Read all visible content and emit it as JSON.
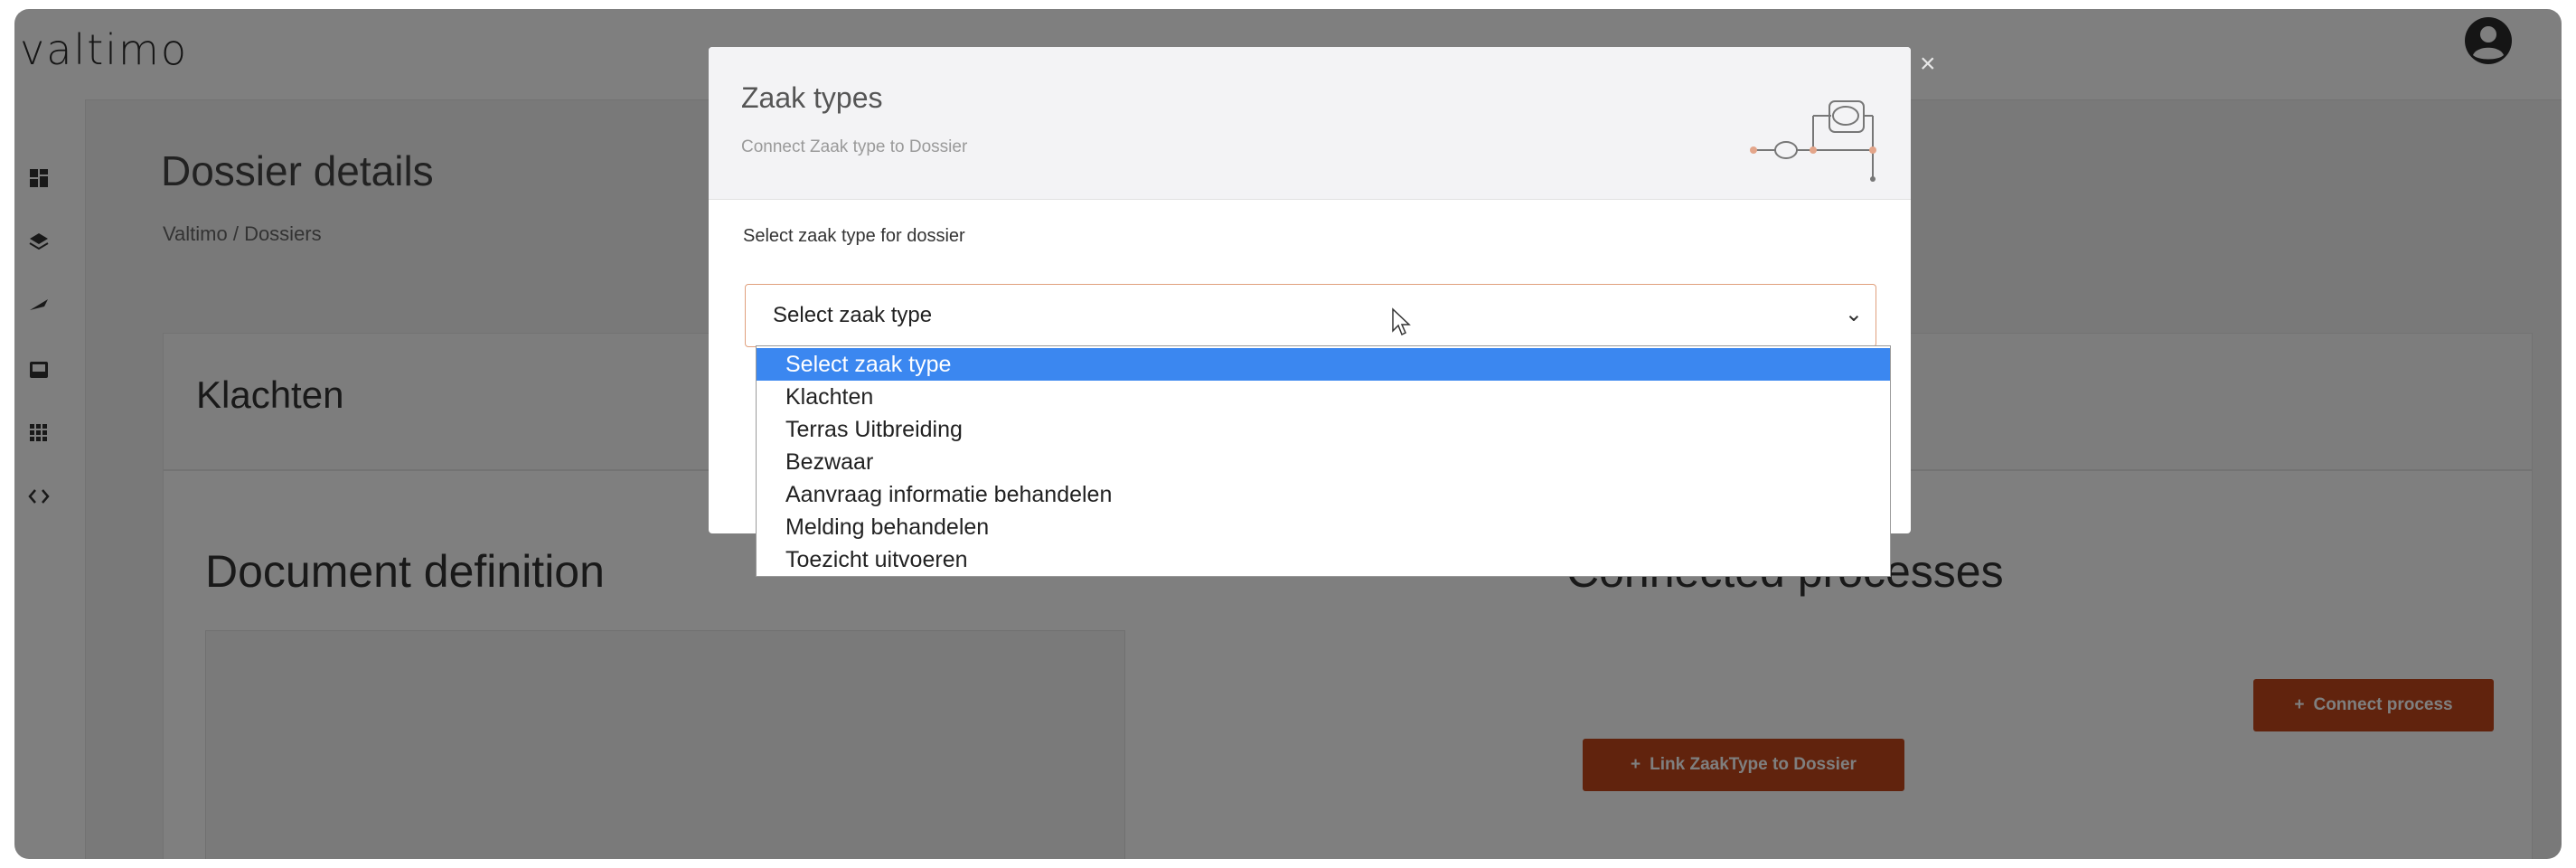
{
  "app": {
    "logo": "valtimo"
  },
  "page": {
    "title": "Dossier details",
    "breadcrumb": "Valtimo / Dossiers"
  },
  "card": {
    "header_title": "Klachten",
    "document_definition_title": "Document definition",
    "connected_processes_title": "Connected processes",
    "connect_process_label": "Connect process",
    "link_zaaktype_label": "Link ZaakType to Dossier"
  },
  "modal": {
    "title": "Zaak types",
    "subtitle": "Connect Zaak type to Dossier",
    "field_label": "Select zaak type for dossier",
    "select": {
      "value": "Select zaak type",
      "options": [
        "Select zaak type",
        "Klachten",
        "Terras Uitbreiding",
        "Bezwaar",
        "Aanvraag informatie behandelen",
        "Melding behandelen",
        "Toezicht uitvoeren"
      ],
      "selected_index": 0
    }
  },
  "icons": {
    "sidebar": [
      "dashboard-icon",
      "layers-icon",
      "plane-icon",
      "inbox-icon",
      "grid-icon",
      "code-icon"
    ],
    "close": "close-icon",
    "user": "user-circle-icon"
  },
  "colors": {
    "accent": "#c2471a",
    "selected_option": "#3b87f0",
    "select_border": "#e0a07d"
  }
}
